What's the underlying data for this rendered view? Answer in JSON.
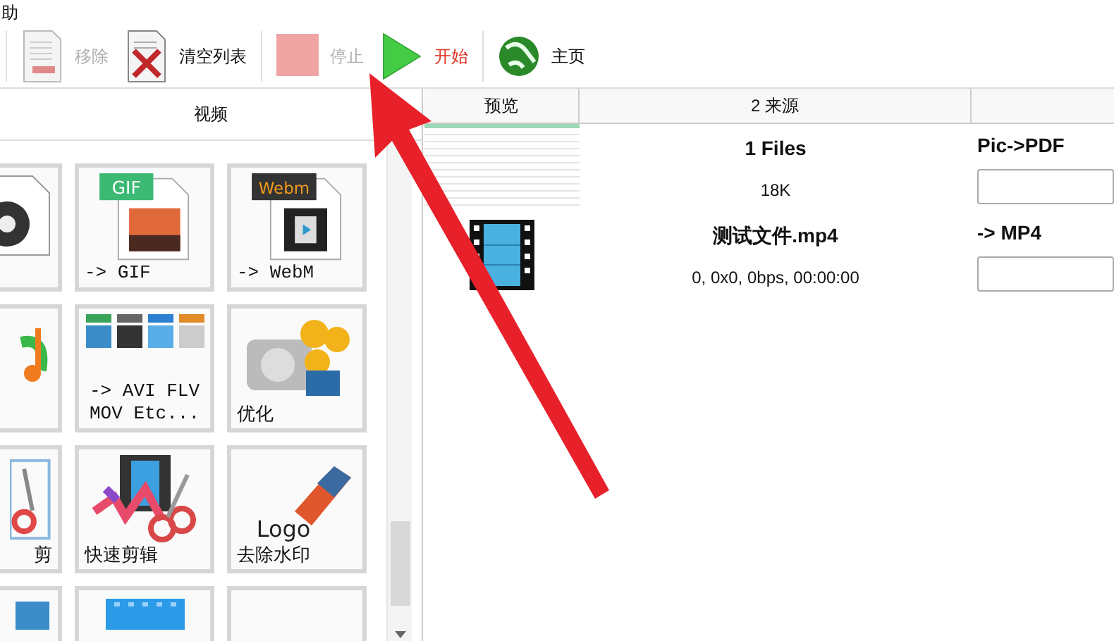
{
  "menu": [
    "助"
  ],
  "toolbar": [
    {
      "kind": "remove",
      "label": "移除",
      "disabled": true,
      "highlighted": false
    },
    {
      "kind": "clear",
      "label": "清空列表",
      "disabled": false,
      "highlighted": false
    },
    {
      "kind": "stop",
      "label": "停止",
      "disabled": true,
      "highlighted": false
    },
    {
      "kind": "start",
      "label": "开始",
      "disabled": false,
      "highlighted": true
    },
    {
      "kind": "home",
      "label": "主页",
      "disabled": false,
      "highlighted": false
    }
  ],
  "panel": {
    "title": "视频",
    "tiles": [
      {
        "kind": "disc"
      },
      {
        "kind": "gif",
        "badge": "GIF",
        "label": "-> GIF"
      },
      {
        "kind": "webm",
        "badge": "Webm",
        "label": "-> WebM"
      },
      {
        "kind": "music"
      },
      {
        "kind": "formats",
        "label": "-> AVI FLV MOV Etc..."
      },
      {
        "kind": "gears",
        "label": "优化"
      },
      {
        "kind": "crop",
        "label": "剪"
      },
      {
        "kind": "quickcut",
        "label": "快速剪辑"
      },
      {
        "kind": "eraser",
        "badge": "Logo",
        "label": "去除水印"
      },
      {
        "kind": "screen"
      },
      {
        "kind": "strip"
      },
      {
        "kind": "blank"
      }
    ]
  },
  "table": {
    "columns": [
      "预览",
      "2 来源"
    ],
    "rows": [
      {
        "kind": "spreadsheet",
        "source": "1 Files",
        "detail": "18K",
        "target": "Pic->PDF"
      },
      {
        "kind": "film",
        "source": "测试文件.mp4",
        "detail": "0, 0x0, 0bps, 00:00:00",
        "target": "-> MP4"
      }
    ]
  }
}
